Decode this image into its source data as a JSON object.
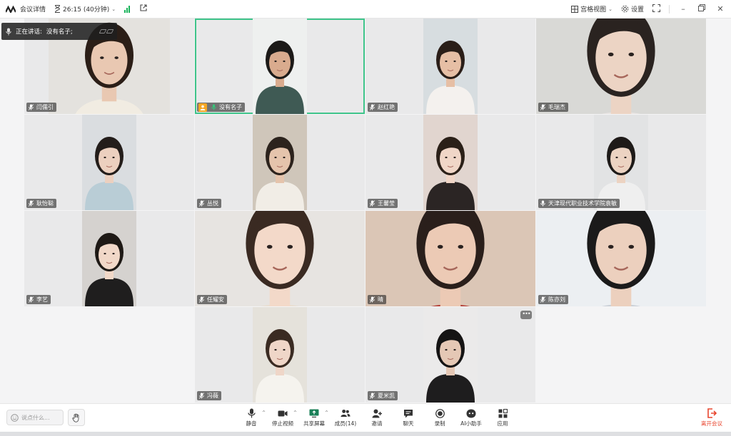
{
  "titlebar": {
    "meeting_details": "会议详情",
    "duration": "26:15 (40分钟)",
    "view_mode": "宫格视图",
    "settings": "设置"
  },
  "speaking": {
    "label": "正在讲话:",
    "name": "没有名子;"
  },
  "participants": [
    {
      "name": "闫儒引",
      "mic": "muted",
      "skin": "#e9c8b2",
      "hair": "#2b1e17",
      "cloth": "#f1ece2",
      "bg": "#e4e2de"
    },
    {
      "name": "没有名子",
      "mic": "speaking",
      "host": true,
      "active": true,
      "skin": "#d9ab8e",
      "hair": "#1c1a18",
      "cloth": "#3f5a54",
      "bg": "#eef0ef"
    },
    {
      "name": "赵红艳",
      "mic": "muted",
      "skin": "#e6bfa5",
      "hair": "#2a1e18",
      "cloth": "#f4f1ee",
      "bg": "#d7dde0"
    },
    {
      "name": "毛瑞杰",
      "mic": "muted",
      "skin": "#ecd4c4",
      "hair": "#2a2320",
      "cloth": "#e8e4e2",
      "bg": "#d9d9d6"
    },
    {
      "name": "耿怡聪",
      "mic": "muted",
      "skin": "#ecd0bf",
      "hair": "#231d1a",
      "cloth": "#b9cdd6",
      "bg": "#dadde0"
    },
    {
      "name": "丛悦",
      "mic": "muted",
      "skin": "#e5c4ac",
      "hair": "#2c231d",
      "cloth": "#f1ede6",
      "bg": "#cfc6ba"
    },
    {
      "name": "王馨莹",
      "mic": "muted",
      "skin": "#f0d6c7",
      "hair": "#2b2018",
      "cloth": "#2b2524",
      "bg": "#e1d5cf"
    },
    {
      "name": "天津现代职业技术学院袁敏",
      "mic": "off",
      "skin": "#ecd3c2",
      "hair": "#1e1a18",
      "cloth": "#efefef",
      "bg": "#e2e3e4"
    },
    {
      "name": "李艺",
      "mic": "muted",
      "skin": "#f1d8c8",
      "hair": "#1e1915",
      "cloth": "#1f1e1e",
      "bg": "#d5d2cf"
    },
    {
      "name": "任耀安",
      "mic": "muted",
      "skin": "#f3d9c9",
      "hair": "#3a2a22",
      "cloth": "#e9ded0",
      "bg": "#e7e4e1"
    },
    {
      "name": "晴",
      "mic": "muted",
      "skin": "#eccab5",
      "hair": "#2a1f1b",
      "cloth": "#b23b33",
      "bg": "#dbc6b6"
    },
    {
      "name": "陈亦刘",
      "mic": "muted",
      "skin": "#ecd0be",
      "hair": "#1b1a1a",
      "cloth": "#c9cfd6",
      "bg": "#eceff2"
    },
    {
      "name": "冯薇",
      "mic": "muted",
      "skin": "#efd6c8",
      "hair": "#3a2b22",
      "cloth": "#f5f3ee",
      "bg": "#e5e2db"
    },
    {
      "name": "夏米凯",
      "mic": "muted",
      "more": true,
      "skin": "#e5c8b5",
      "hair": "#151414",
      "cloth": "#1e1d1e",
      "bg": "#ebeaea"
    }
  ],
  "chat": {
    "placeholder": "说点什么..."
  },
  "toolbar": [
    {
      "label": "静音",
      "icon": "mic-icon",
      "caret": true
    },
    {
      "label": "停止视频",
      "icon": "camera-icon",
      "caret": true
    },
    {
      "label": "共享屏幕",
      "icon": "share-screen-icon",
      "caret": true
    },
    {
      "label": "成员(14)",
      "icon": "members-icon"
    },
    {
      "label": "邀请",
      "icon": "invite-icon"
    },
    {
      "label": "聊天",
      "icon": "chat-icon"
    },
    {
      "label": "录制",
      "icon": "record-icon"
    },
    {
      "label": "AI小助手",
      "icon": "ai-assistant-icon"
    },
    {
      "label": "应用",
      "icon": "apps-icon"
    }
  ],
  "leave": {
    "label": "离开会议"
  },
  "colors": {
    "active_border": "#3ec48a",
    "leave": "#e8462f",
    "signal": "#19b35a"
  }
}
